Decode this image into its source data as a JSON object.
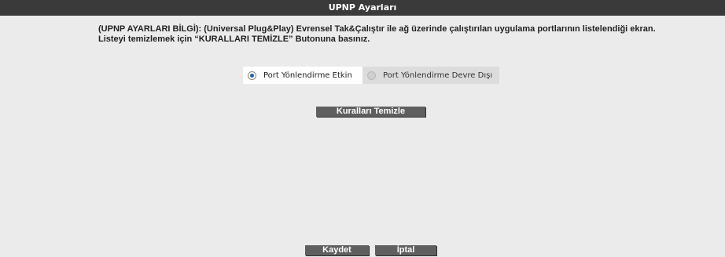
{
  "header": {
    "title": "UPNP Ayarları"
  },
  "info": {
    "line1": "(UPNP AYARLARI BİLGİ): (Universal Plug&Play) Evrensel Tak&Çalıştır ile ağ üzerinde çalıştırılan uygulama portlarının listelendiği ekran.",
    "line2": "Listeyi temizlemek için “KURALLARI TEMİZLE” Butonuna basınız."
  },
  "port_forwarding": {
    "options": [
      {
        "label": "Port Yönlendirme Etkin",
        "checked": true
      },
      {
        "label": "Port Yönlendirme Devre Dışı",
        "checked": false
      }
    ]
  },
  "buttons": {
    "clear_rules": "Kuralları Temizle",
    "save": "Kaydet",
    "cancel": "İptal"
  }
}
